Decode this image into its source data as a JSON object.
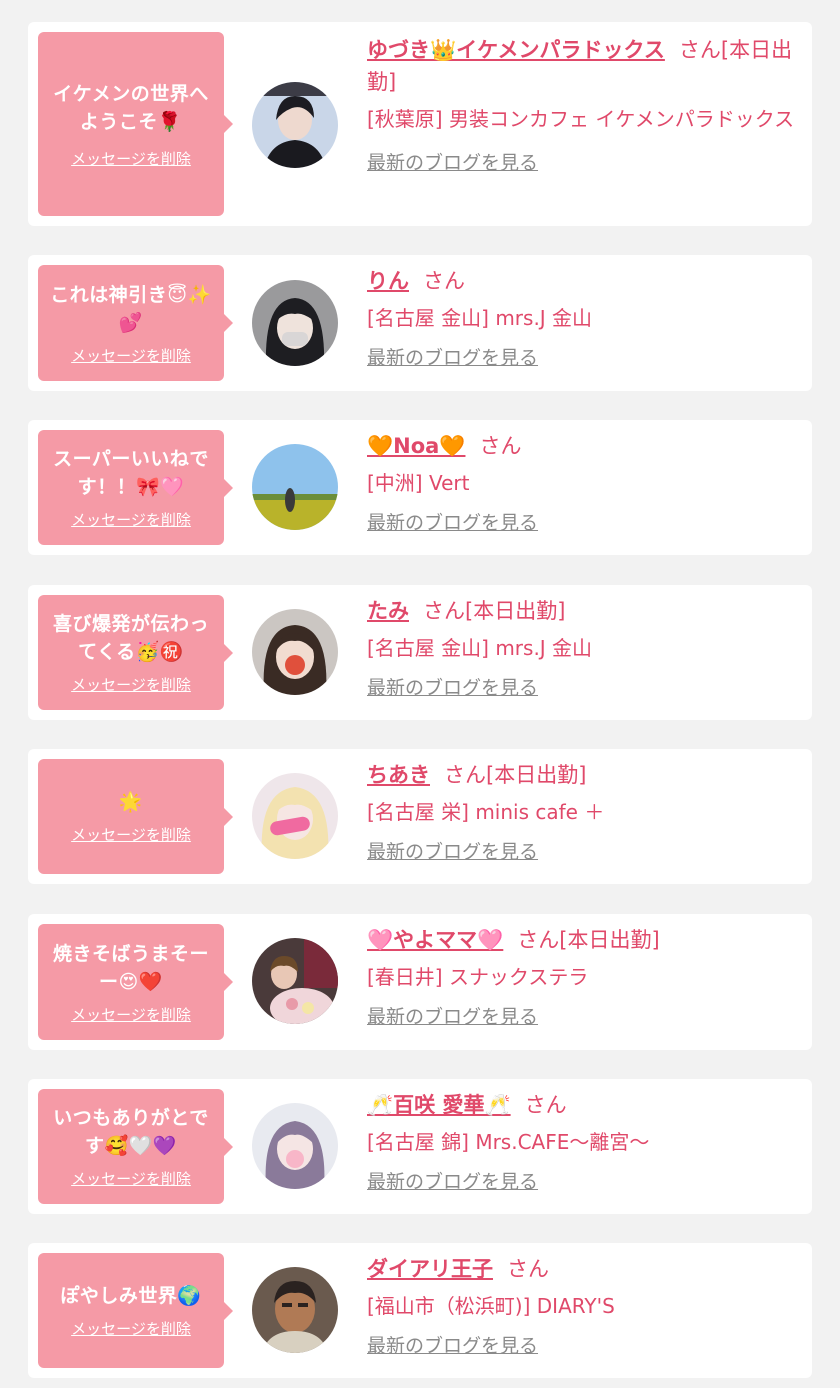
{
  "colors": {
    "accent": "#e0496a",
    "bubble": "#f59aa6",
    "link_gray": "#8a8a8a"
  },
  "items": [
    {
      "message": "イケメンの世界へようこそ🌹",
      "delete_label": "メッセージを削除",
      "name": "ゆづき👑イケメンパラドックス",
      "honorific": "さん[本日出勤]",
      "shop": "[秋葉原] 男装コンカフェ イケメンパラドックス",
      "blog_label": "最新のブログを見る"
    },
    {
      "message": "これは神引き😇✨💕",
      "delete_label": "メッセージを削除",
      "name": "りん",
      "honorific": "さん",
      "shop": "[名古屋 金山] mrs.J 金山",
      "blog_label": "最新のブログを見る"
    },
    {
      "message": "スーパーいいねです！！🎀🩷",
      "delete_label": "メッセージを削除",
      "name": "🧡Noa🧡",
      "honorific": "さん",
      "shop": "[中洲] Vert",
      "blog_label": "最新のブログを見る"
    },
    {
      "message": "喜び爆発が伝わってくる🥳㊗️",
      "delete_label": "メッセージを削除",
      "name": "たみ",
      "honorific": "さん[本日出勤]",
      "shop": "[名古屋 金山] mrs.J 金山",
      "blog_label": "最新のブログを見る"
    },
    {
      "message": "🌟",
      "delete_label": "メッセージを削除",
      "name": "ちあき",
      "honorific": "さん[本日出勤]",
      "shop": "[名古屋 栄] minis cafe ＋",
      "blog_label": "最新のブログを見る"
    },
    {
      "message": "焼きそばうまそーー😍❤️",
      "delete_label": "メッセージを削除",
      "name": "🩷やよママ🩷",
      "honorific": "さん[本日出勤]",
      "shop": "[春日井] スナックステラ",
      "blog_label": "最新のブログを見る"
    },
    {
      "message": "いつもありがとです🥰🤍💜",
      "delete_label": "メッセージを削除",
      "name": "🥂百咲 愛華🥂",
      "honorific": "さん",
      "shop": "[名古屋 錦] Mrs.CAFE〜離宮〜",
      "blog_label": "最新のブログを見る"
    },
    {
      "message": "ぽやしみ世界🌍",
      "delete_label": "メッセージを削除",
      "name": "ダイアリ王子",
      "honorific": "さん",
      "shop": "[福山市（松浜町)] DIARY'S",
      "blog_label": "最新のブログを見る"
    }
  ]
}
